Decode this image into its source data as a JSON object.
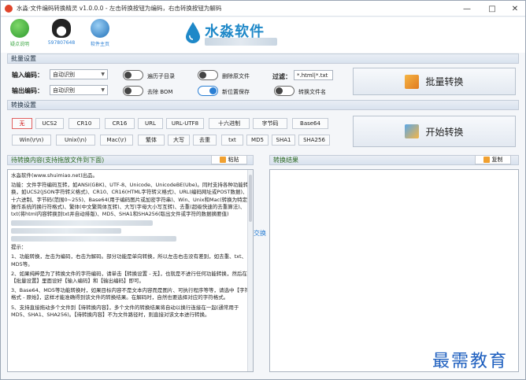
{
  "window": {
    "title": "水淼·文件编码转换精灵 v1.0.0.0 - 左击转换按钮为编码，右击转换按钮为解码",
    "controls": [
      "—",
      "□",
      "✕"
    ]
  },
  "toolbar": {
    "buttons": [
      {
        "label": "疑点说明",
        "icon": "help-icon",
        "color": "#3aa640"
      },
      {
        "label": "597807648",
        "icon": "qq-penguin-icon",
        "color": "#222222"
      },
      {
        "label": "软件主页",
        "icon": "globe-icon",
        "color": "#2a7fd4"
      }
    ],
    "logo_text": "水淼软件"
  },
  "batch": {
    "section_title": "批量设置",
    "input_encoding_label": "输入编码：",
    "input_encoding_value": "自动识别",
    "output_encoding_label": "输出编码：",
    "output_encoding_value": "自动识别",
    "toggles": [
      {
        "label": "遍历子目录",
        "on": false
      },
      {
        "label": "删除原文件",
        "on": false
      },
      {
        "label": "去除 BOM",
        "on": false
      },
      {
        "label": "新位置保存",
        "on": true
      },
      {
        "label": "转换文件名",
        "on": false
      }
    ],
    "filter_label": "过滤：",
    "filter_value": "*.html|*.txt",
    "convert_button": "批量转换"
  },
  "convert": {
    "section_title": "转换设置",
    "row1": [
      "无",
      "UCS2",
      "CR10",
      "CR16",
      "URL",
      "URL-UTF8",
      "十六进制",
      "字节码",
      "Base64"
    ],
    "row2": [
      "Win(\\r\\n)",
      "Unix(\\n)",
      "Mac(\\r)",
      "繁体",
      "大写",
      "去重",
      "txt",
      "MD5",
      "SHA1",
      "SHA256"
    ],
    "selected": "无",
    "start_button": "开始转换"
  },
  "panes": {
    "input_title": "待转换内容(支持拖放文件到下面)",
    "paste_button": "粘贴",
    "output_title": "转换结果",
    "copy_button": "复制",
    "swap_label": "交换",
    "input_text": [
      "水淼软件(www.shuimiao.net)出品。",
      "功能：文件字符编码互转，如ANSI(GBK)、UTF-8、Unicode、UnicodeBE(Ube)。同时支持各种功能转换，如UCS2(JSON字符转义格式)、CR10、CR16(HTML字符转义格式)、URL(编码网址或POST数据)、十六进制、字节码(范围0~255)、Base64(用于编码图片或加密字符串)、Win、Unix和Mac(转换为特定操作系统的换行符格式)、繁体(中文繁简体互转)、大写(字母大小写互转)、去重(超级快速的去重算法)、txt(将html内容转换到txt并自动排版)、MD5、SHA1和SHA256(取出文件或字符的数据摘要值)",
      "提示：",
      "1、功能转换，左击为编码，右击为解码。部分功能是单向转换，所以左击右击没有差别，如去重、txt、MD5等。",
      "2、如果纯粹是为了转换文件的字符编码，请单击【转换设置 - 无】，也就是不进行任何功能转换，然后在【批量设置】里面设好【输入编码】和【输出编码】即可。",
      "3、Base64、MD5等功能转换时，如果目标内容不是文本内容而是图片、可执行程序等等，请选中【字符格式 - 原始】，这样才能准确得到该文件的转换结果。在解码时，自然也要选择对应的字符格式。",
      "5、支持直接拖动多个文件到【待转换内容】，多个文件的转换结果将自动以换行连接在一起(通常用于MD5、SHA1、SHA256)。【待转换内容】不为文件路径时，则直接对该文本进行转换。"
    ]
  },
  "watermark": "最需教育"
}
